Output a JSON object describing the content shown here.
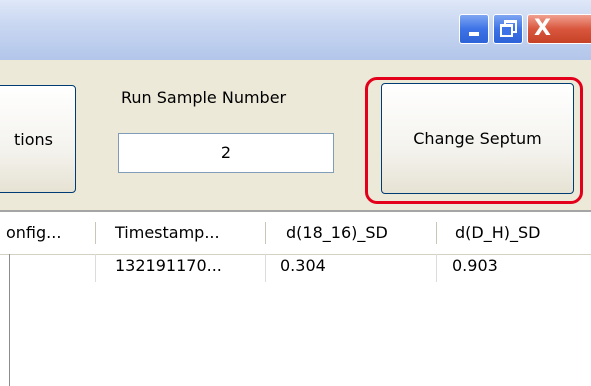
{
  "window": {
    "minimize_icon": "minimize-icon",
    "restore_icon": "restore-icon",
    "close_icon": "close-icon",
    "close_glyph": "X"
  },
  "toolbar": {
    "left_button_label": "tions",
    "run_sample_label": "Run Sample Number",
    "run_sample_value": "2",
    "change_septum_label": "Change Septum"
  },
  "grid": {
    "columns": [
      "onfig...",
      "Timestamp...",
      "d(18_16)_SD",
      "d(D_H)_SD"
    ],
    "rows": [
      [
        "",
        "132191170...",
        "0.304",
        "0.903"
      ]
    ]
  },
  "colors": {
    "highlight": "#e3001b",
    "titlebar": "#c9d7f1",
    "close_button": "#d9573d"
  }
}
